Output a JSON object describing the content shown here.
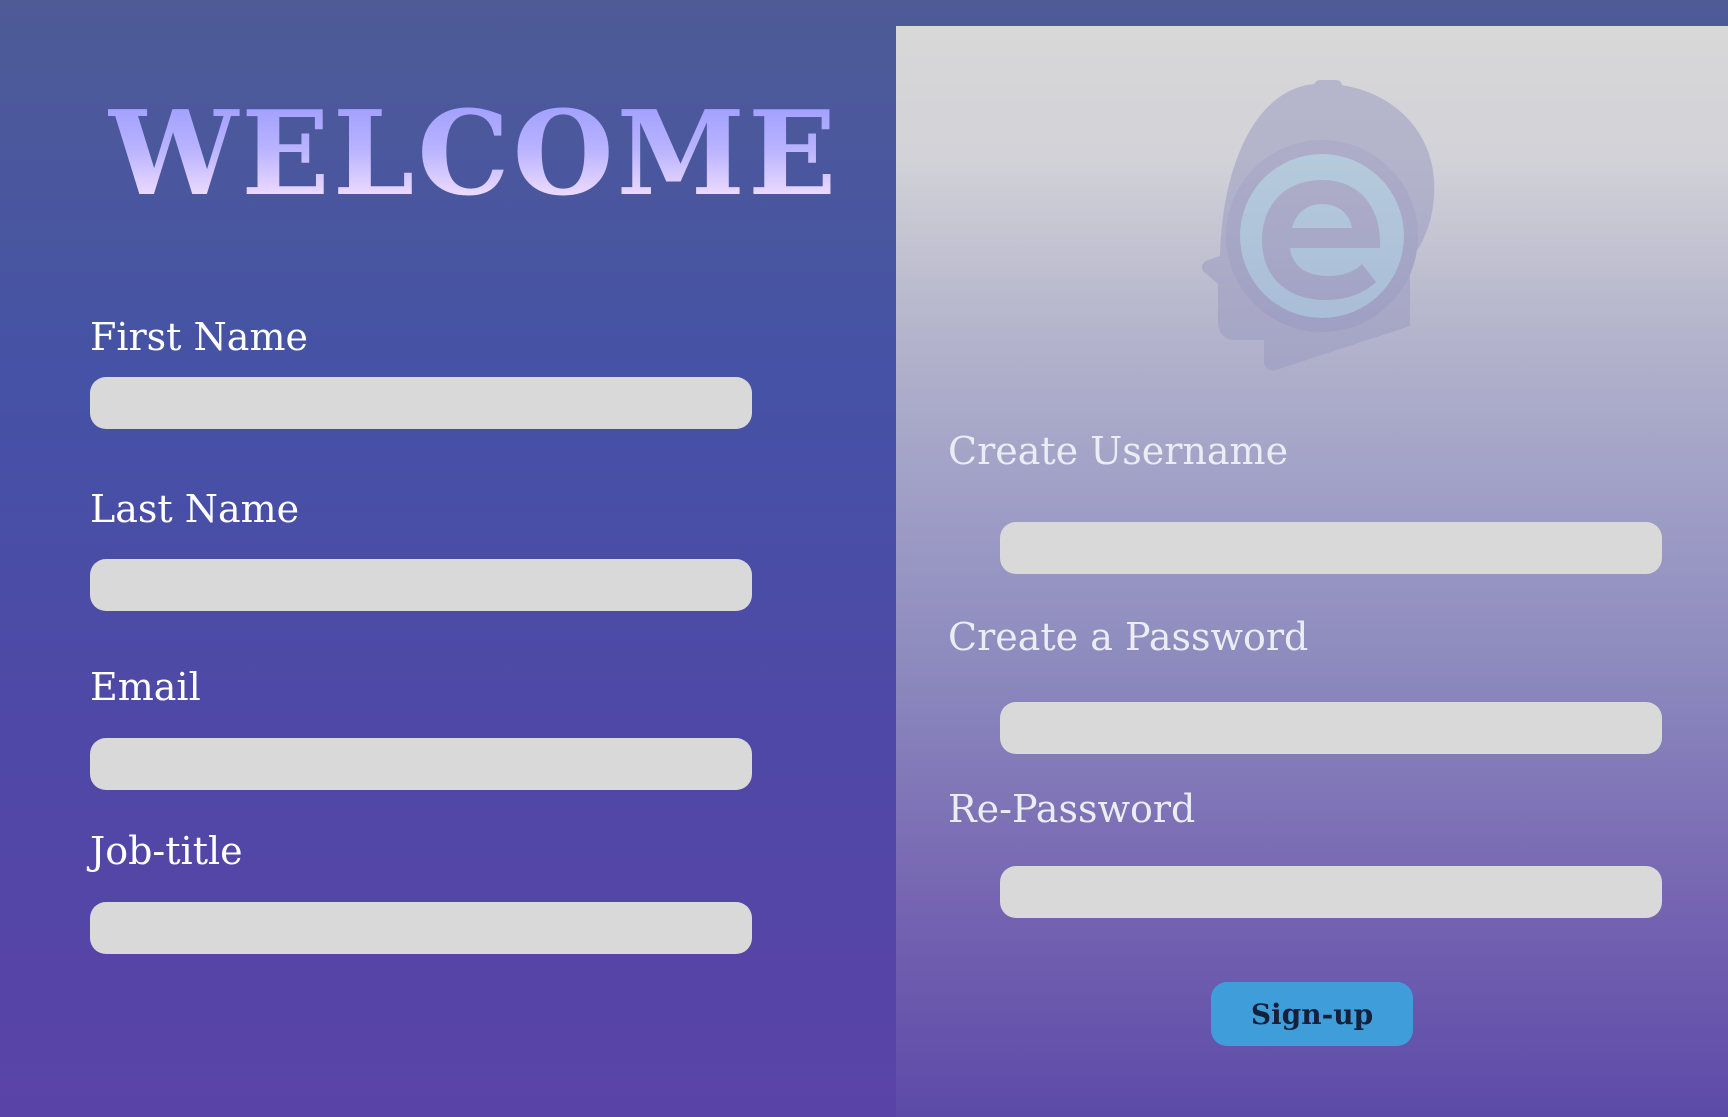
{
  "header": {
    "title": "WELCOME !"
  },
  "personal_form": {
    "fields": [
      {
        "label": "First Name",
        "value": ""
      },
      {
        "label": "Last Name",
        "value": ""
      },
      {
        "label": "Email",
        "value": ""
      },
      {
        "label": "Job-title",
        "value": ""
      }
    ]
  },
  "account_form": {
    "logo_icon": "e-logo-head-icon",
    "fields": [
      {
        "label": "Create Username",
        "value": ""
      },
      {
        "label": "Create a Password",
        "value": ""
      },
      {
        "label": "Re-Password",
        "value": ""
      }
    ],
    "submit_label": "Sign-up"
  },
  "colors": {
    "background_top": "#4e5b97",
    "background_bottom": "#5a43a7",
    "input_fill": "#d9d9d9",
    "button_fill": "#3f9ed9"
  }
}
